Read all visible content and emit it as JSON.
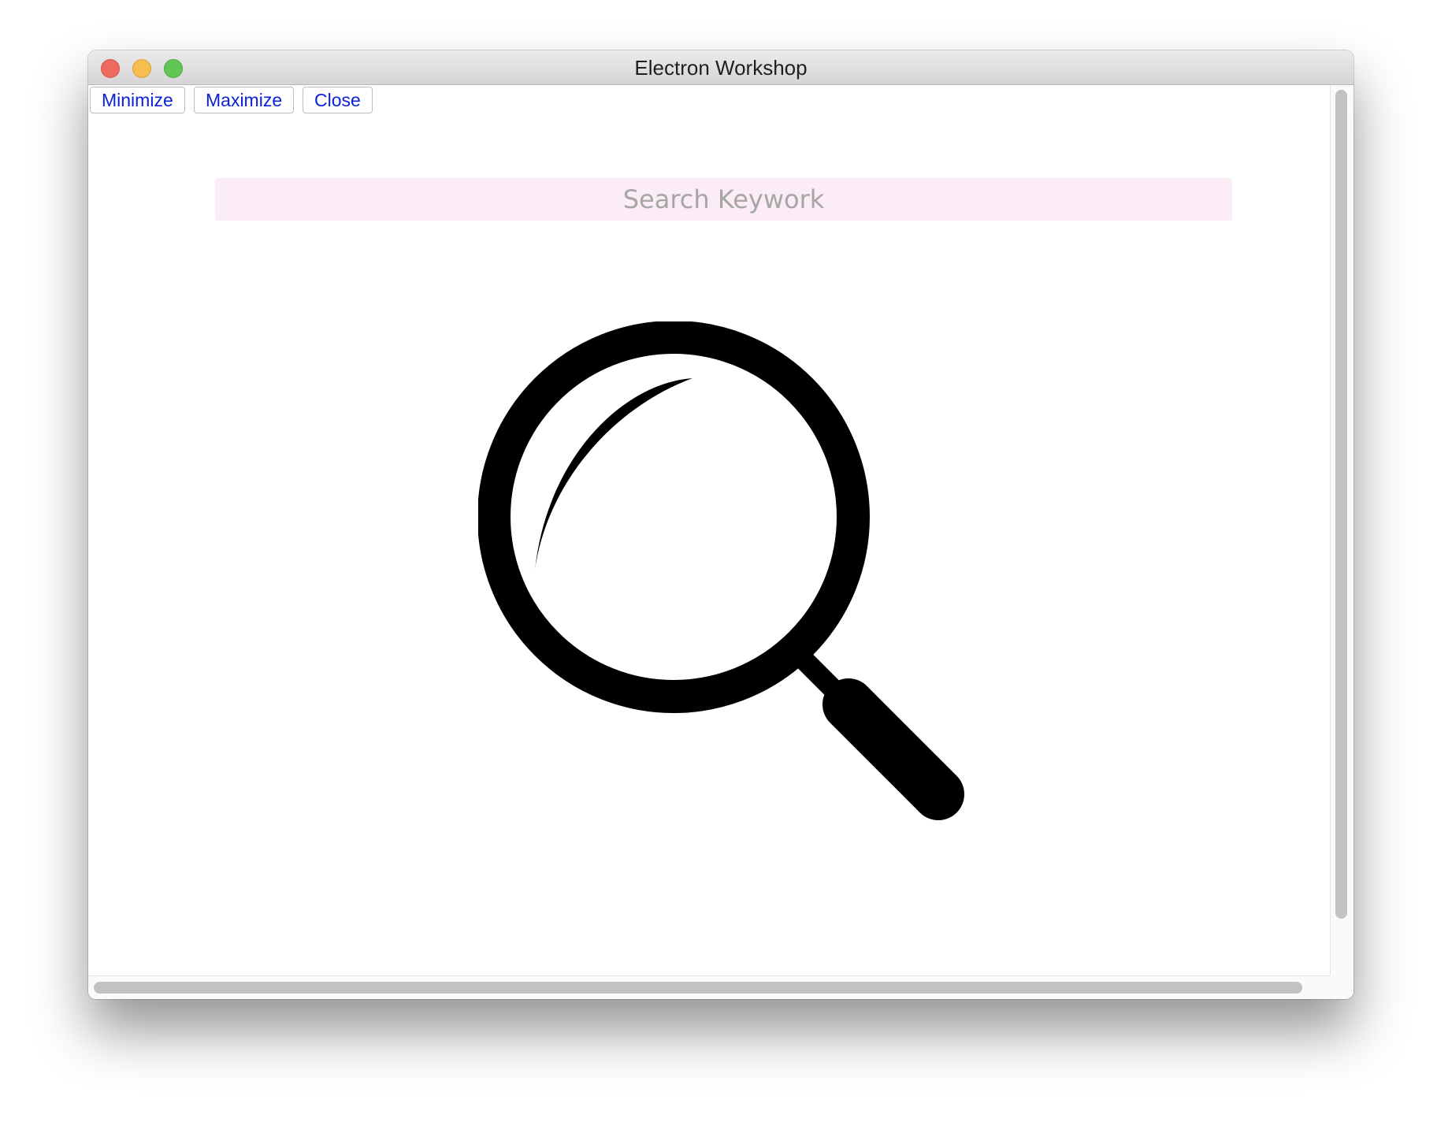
{
  "window": {
    "title": "Electron Workshop",
    "traffic_lights": {
      "close_color": "#ee6a5f",
      "minimize_color": "#f5be4f",
      "maximize_color": "#62c655"
    }
  },
  "toolbar": {
    "minimize_label": "Minimize",
    "maximize_label": "Maximize",
    "close_label": "Close",
    "label_color": "#0b21d8"
  },
  "search": {
    "placeholder": "Search Keywork",
    "value": "",
    "background_color": "#fbecf6"
  },
  "main": {
    "icon": "magnifying-glass-icon"
  },
  "scrollbars": {
    "vertical": true,
    "horizontal": true
  }
}
